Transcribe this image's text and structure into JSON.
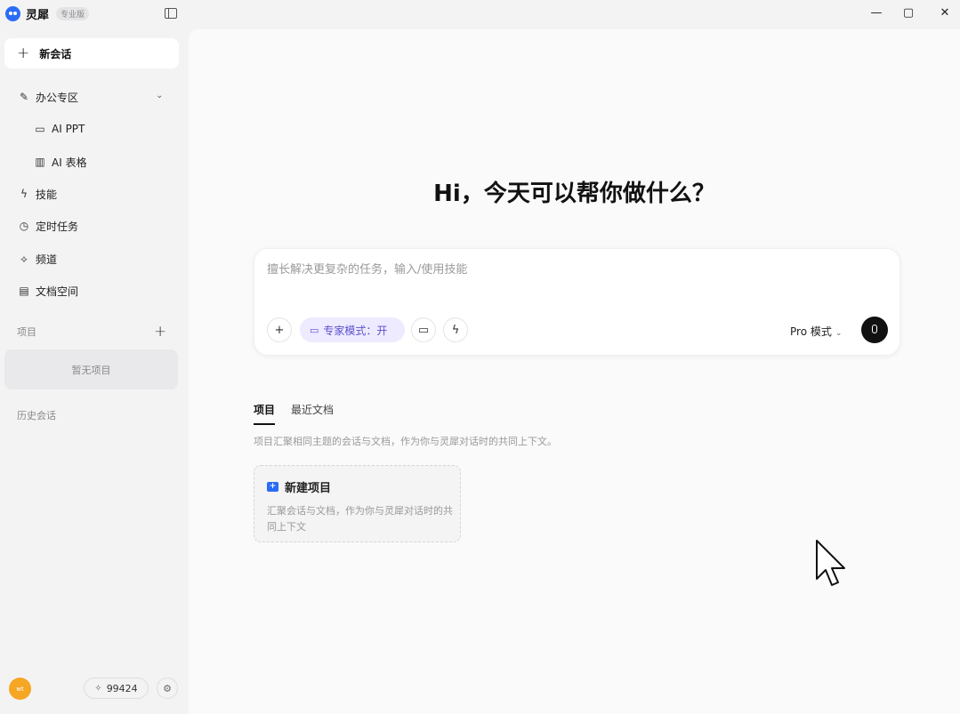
{
  "app": {
    "name": "灵犀",
    "badge": "专业版"
  },
  "sidebar": {
    "new_chat_label": "新会话",
    "office": {
      "label": "办公专区",
      "items": [
        {
          "label": "AI PPT",
          "icon": "slides-icon"
        },
        {
          "label": "AI 表格",
          "icon": "chart-icon"
        }
      ]
    },
    "nav": [
      {
        "label": "技能",
        "icon": "lightning-icon"
      },
      {
        "label": "定时任务",
        "icon": "clock-icon"
      },
      {
        "label": "频道",
        "icon": "channel-icon"
      },
      {
        "label": "文档空间",
        "icon": "document-icon"
      }
    ],
    "projects_label": "项目",
    "projects_empty": "暂无项目",
    "history_label": "历史会话",
    "avatar_text": "wt",
    "points": "99424"
  },
  "main": {
    "headline": "Hi，今天可以帮你做什么？",
    "composer": {
      "placeholder": "擅长解决更复杂的任务，输入/使用技能",
      "expert_mode_label": "专家模式：开",
      "pro_mode_label": "Pro 模式"
    },
    "tabs": [
      {
        "label": "项目",
        "active": true
      },
      {
        "label": "最近文档",
        "active": false
      }
    ],
    "tab_description": "项目汇聚相同主题的会话与文档，作为你与灵犀对话时的共同上下文。",
    "new_project": {
      "title": "新建项目",
      "description": "汇聚会话与文档，作为你与灵犀对话时的共同上下文"
    }
  },
  "colors": {
    "accent": "#2b6cf6",
    "expert_chip_bg": "#eeeaff",
    "expert_chip_text": "#5a4fd1",
    "avatar": "#f5a623"
  }
}
